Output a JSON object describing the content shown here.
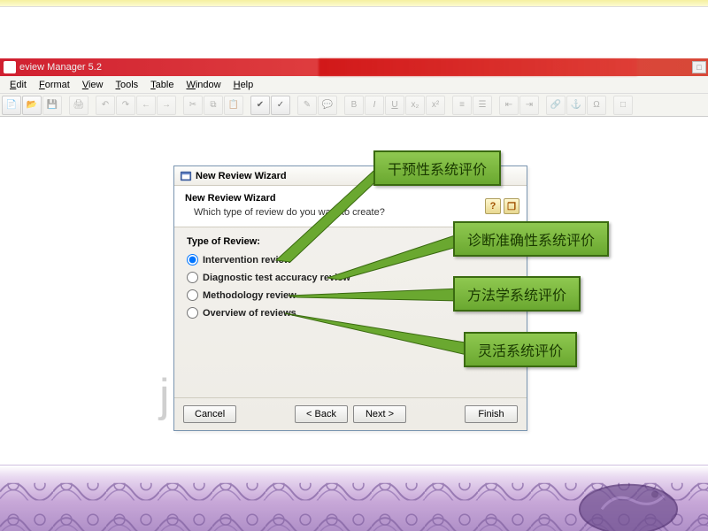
{
  "app": {
    "title": "eview Manager 5.2"
  },
  "menu": {
    "edit": "Edit",
    "format": "Format",
    "view": "View",
    "tools": "Tools",
    "table": "Table",
    "window": "Window",
    "help": "Help"
  },
  "wizard": {
    "title": "New Review Wizard",
    "head_title": "New Review Wizard",
    "head_sub": "Which type of review do you want to create?",
    "body_label": "Type of Review:",
    "options": {
      "intervention": "Intervention review",
      "diagnostic": "Diagnostic test accuracy review",
      "methodology": "Methodology review",
      "overview": "Overview of reviews"
    },
    "buttons": {
      "cancel": "Cancel",
      "back": "< Back",
      "next": "Next >",
      "finish": "Finish"
    },
    "help": {
      "q": "?",
      "book": "📕"
    }
  },
  "callouts": {
    "c1": "干预性系统评价",
    "c2": "诊断准确性系统评价",
    "c3": "方法学系统评价",
    "c4": "灵活系统评价"
  },
  "watermark": "jinchutou.com"
}
